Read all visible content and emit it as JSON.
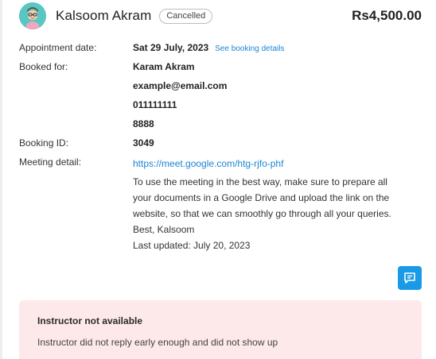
{
  "header": {
    "name": "Kalsoom Akram",
    "status": "Cancelled",
    "price": "Rs4,500.00"
  },
  "details": {
    "appointment_label": "Appointment date:",
    "appointment_date": "Sat 29 July, 2023",
    "see_booking_link": "See booking details",
    "booked_for_label": "Booked for:",
    "booked_for_name": "Karam Akram",
    "booked_for_email": "example@email.com",
    "booked_for_phone": "011111111",
    "booked_for_extra": "8888",
    "booking_id_label": "Booking ID:",
    "booking_id": "3049",
    "meeting_label": "Meeting detail:",
    "meeting_link": "https://meet.google.com/htg-rjfo-phf",
    "meeting_message_lines": [
      "To use the meeting in the best way, make sure to prepare all",
      "your documents in a Google Drive and upload the link on the",
      "website, so that we can smoothly go through all your queries.",
      "Best, Kalsoom"
    ],
    "last_updated": "Last updated: July 20, 2023"
  },
  "icons": {
    "chat": "chat-icon",
    "avatar": "avatar"
  },
  "notice": {
    "title": "Instructor not available",
    "text": "Instructor did not reply early enough and did not show up"
  },
  "colors": {
    "accent": "#1a9ae6",
    "link": "#1a86d6",
    "notice_bg": "#fde9e9",
    "avatar_bg": "#58c6c2"
  }
}
